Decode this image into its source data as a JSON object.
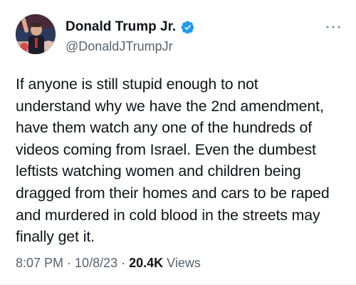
{
  "author": {
    "display_name": "Donald Trump Jr.",
    "handle": "@DonaldJTrumpJr",
    "verified": true,
    "verified_color": "#1d9bf0"
  },
  "tweet": {
    "text": "If anyone is still stupid enough to not\nunderstand why we have the 2nd amendment,\nhave them watch any one of the hundreds of\nvideos coming from Israel. Even the dumbest\nleftists watching women and children being\ndragged from their homes and cars to be raped\nand murdered in cold blood in the streets may\nfinally get it.",
    "time": "8:07 PM",
    "date": "10/8/23",
    "separator": "·",
    "views_count": "20.4K",
    "views_label": "Views"
  },
  "colors": {
    "text_primary": "#0f1419",
    "text_secondary": "#536471",
    "accent": "#1d9bf0"
  },
  "icons": {
    "more": "more-icon",
    "verified": "verified-badge-icon"
  }
}
